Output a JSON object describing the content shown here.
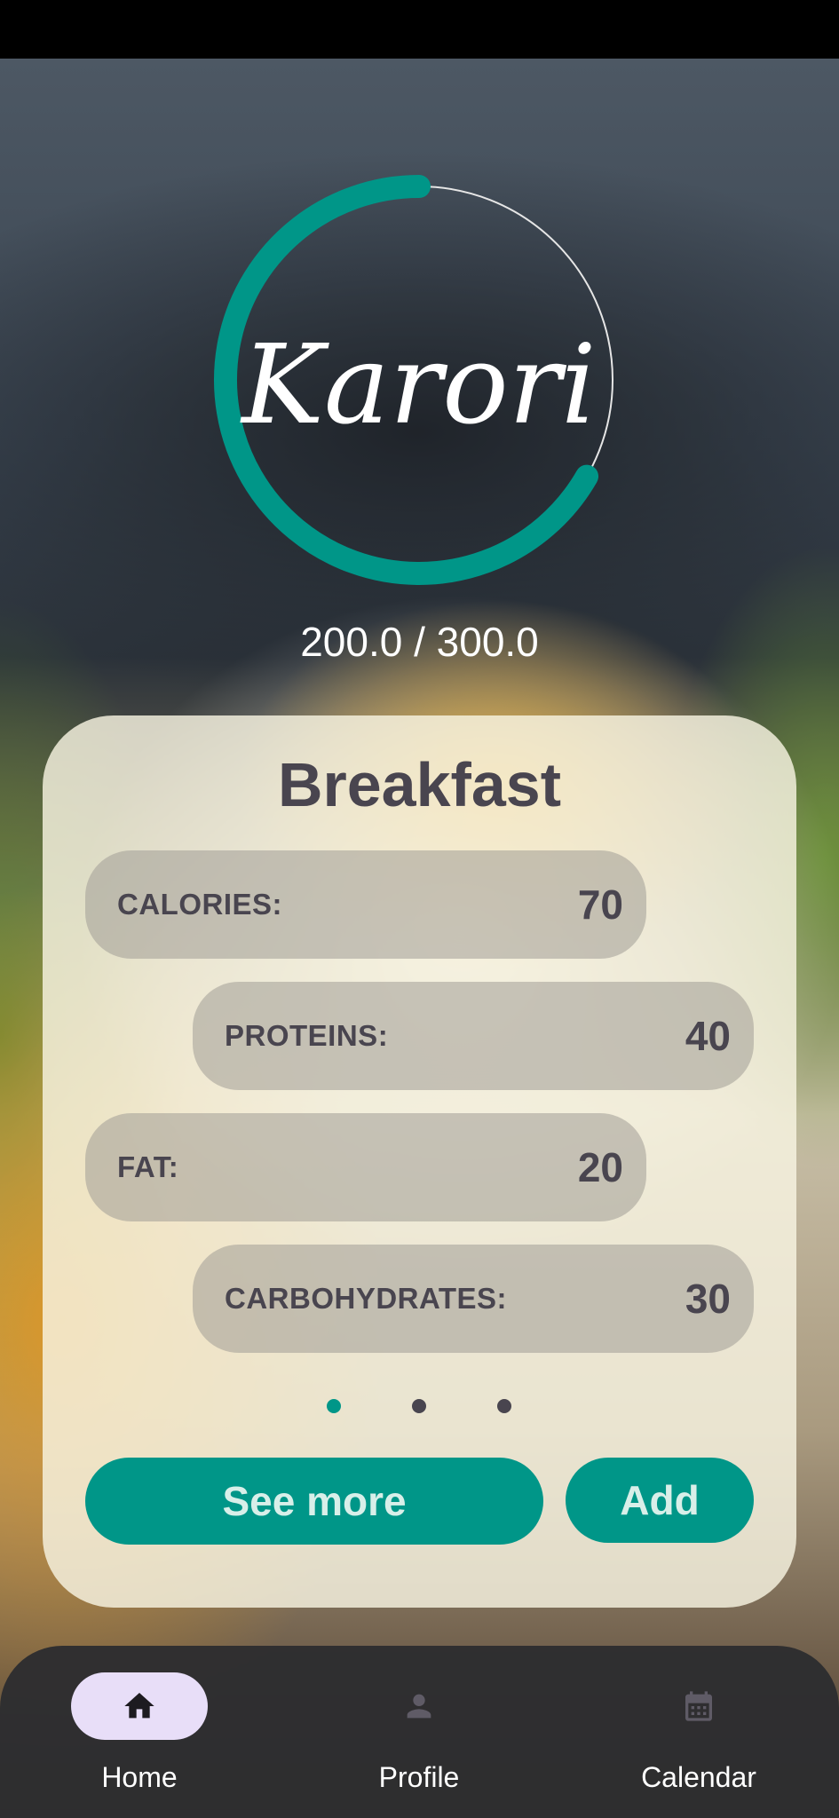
{
  "app": {
    "logo_text": "Karori",
    "progress_text": "200.0 / 300.0",
    "progress_fraction": 0.667,
    "accent_color": "#009688"
  },
  "meal_card": {
    "title": "Breakfast",
    "stats": [
      {
        "label": "CALORIES:",
        "value": "70"
      },
      {
        "label": "PROTEINS:",
        "value": "40"
      },
      {
        "label": "FAT:",
        "value": "20"
      },
      {
        "label": "CARBOHYDRATES:",
        "value": "30"
      }
    ],
    "page_count": 3,
    "active_page": 1,
    "see_more_label": "See more",
    "add_label": "Add"
  },
  "bottom_nav": {
    "items": [
      {
        "label": "Home",
        "icon": "home-icon",
        "active": true
      },
      {
        "label": "Profile",
        "icon": "person-icon",
        "active": false
      },
      {
        "label": "Calendar",
        "icon": "calendar-icon",
        "active": false
      }
    ]
  }
}
